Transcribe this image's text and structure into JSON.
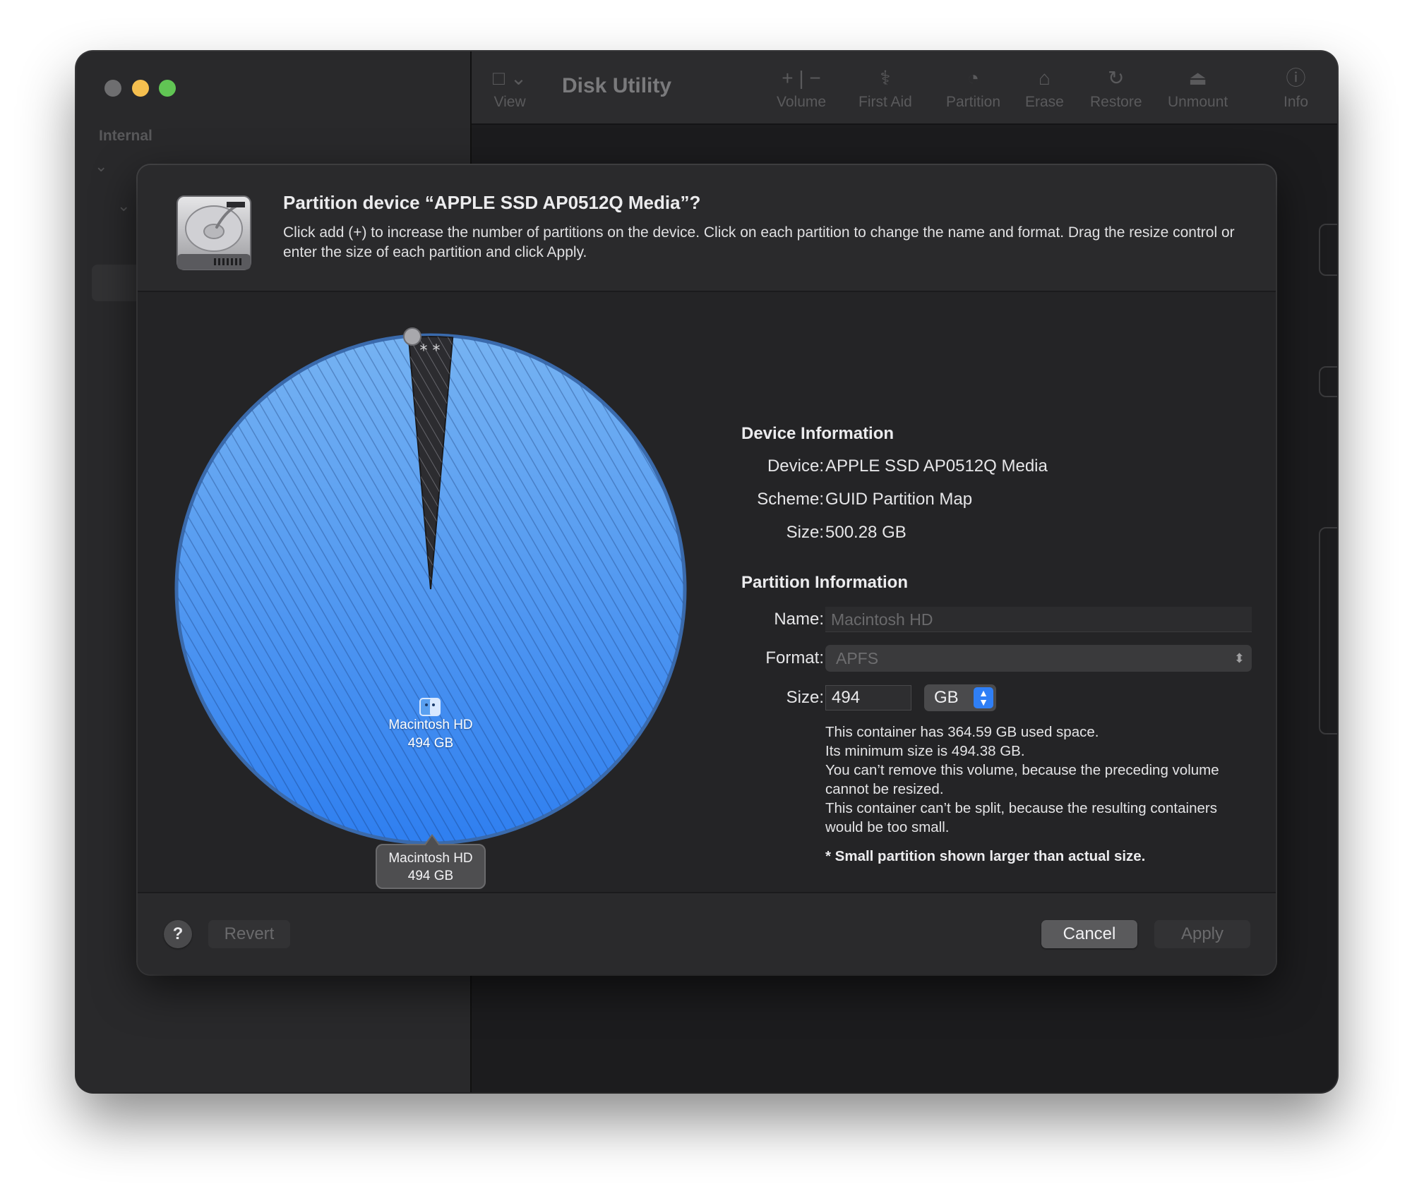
{
  "window": {
    "app_title": "Disk Utility",
    "sidebar_section": "Internal"
  },
  "toolbar": {
    "view": "View",
    "volume": "Volume",
    "first_aid": "First Aid",
    "partition": "Partition",
    "erase": "Erase",
    "restore": "Restore",
    "unmount": "Unmount",
    "info": "Info"
  },
  "sheet": {
    "title": "Partition device “APPLE SSD AP0512Q Media”?",
    "description": "Click add (+) to increase the number of partitions on the device. Click on each partition to change the name and format. Drag the resize control or enter the size of each partition and click Apply."
  },
  "pie": {
    "partition_name": "Macintosh HD",
    "partition_size": "494 GB",
    "small_marker": "* *",
    "tooltip_name": "Macintosh HD",
    "tooltip_size": "494 GB",
    "colors": {
      "fill_top": "#76b3f2",
      "fill_bottom": "#2f7ff0",
      "small_slice": "#2c2c30"
    }
  },
  "device_info": {
    "title": "Device Information",
    "device_label": "Device:",
    "device_value": "APPLE SSD AP0512Q Media",
    "scheme_label": "Scheme:",
    "scheme_value": "GUID Partition Map",
    "size_label": "Size:",
    "size_value": "500.28 GB"
  },
  "partition_info": {
    "title": "Partition Information",
    "name_label": "Name:",
    "name_value": "Macintosh HD",
    "format_label": "Format:",
    "format_value": "APFS",
    "size_label": "Size:",
    "size_value": "494",
    "size_unit": "GB",
    "notes": [
      "This container has 364.59 GB used space.",
      "Its minimum size is 494.38 GB.",
      "You can’t remove this volume, because the preceding volume cannot be resized.",
      "This container can’t be split, because the resulting containers would be too small."
    ],
    "footnote": "* Small partition shown larger than actual size."
  },
  "footer": {
    "help": "?",
    "revert": "Revert",
    "cancel": "Cancel",
    "apply": "Apply"
  }
}
